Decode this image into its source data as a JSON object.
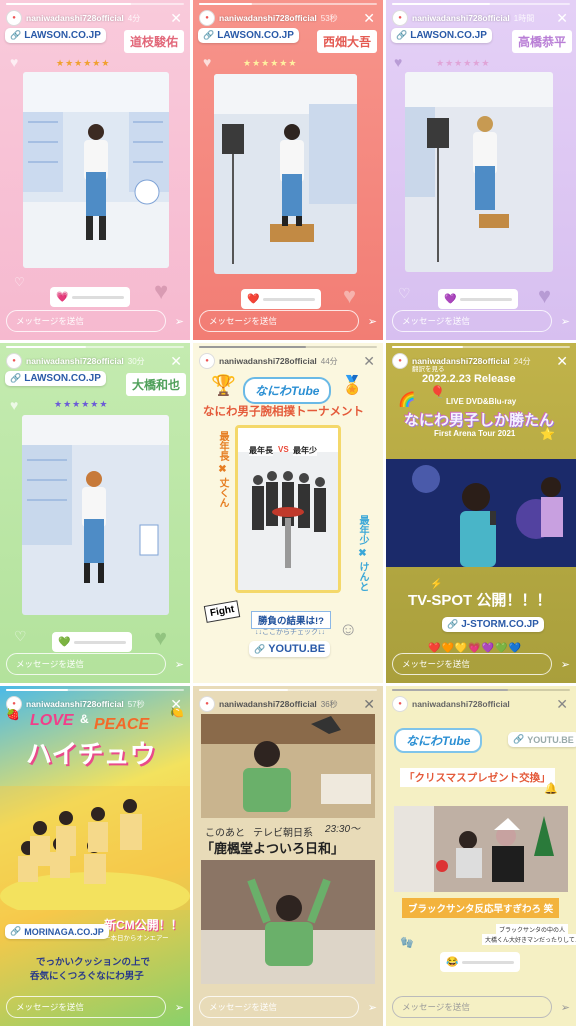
{
  "stories": [
    {
      "user": "naniwadanshi728official",
      "time": "4分",
      "link": "LAWSON.CO.JP",
      "name": "道枝駿佑",
      "name_color": "#e2687a",
      "stars": "★★★★★★",
      "slider_emoji": "💗",
      "message": "メッセージを送信",
      "bg": "#f7c0d3"
    },
    {
      "user": "naniwadanshi728official",
      "time": "53秒",
      "link": "LAWSON.CO.JP",
      "name": "西畑大吾",
      "name_color": "#e45a52",
      "stars": "★★★★★★",
      "slider_emoji": "❤️",
      "message": "メッセージを送信",
      "bg": "#f4867d"
    },
    {
      "user": "naniwadanshi728official",
      "time": "1時間",
      "link": "LAWSON.CO.JP",
      "name": "高橋恭平",
      "name_color": "#b97fd6",
      "stars": "★★★★★★",
      "slider_emoji": "💜",
      "message": "メッセージを送信",
      "bg": "#dcc5f2"
    },
    {
      "user": "naniwadanshi728official",
      "time": "30分",
      "link": "LAWSON.CO.JP",
      "name": "大橋和也",
      "name_color": "#4fa05a",
      "stars": "★★★★★★",
      "slider_emoji": "💚",
      "message": "メッセージを送信",
      "bg": "#b9e6a5"
    },
    {
      "user": "naniwadanshi728official",
      "time": "44分",
      "badge": "なにわTube",
      "title": "なにわ男子腕相撲トーナメント",
      "left_tag": "最年長 ✖ 丈くん",
      "right_tag": "最年少 ✖ けんと",
      "center_left": "最年長",
      "center_vs": "VS",
      "center_right": "最年少",
      "fight": "Fight",
      "result": "勝負の結果は!?",
      "result_sub": "↓↓ここからチェック↓↓",
      "link": "YOUTU.BE",
      "bg": "#fbf7df"
    },
    {
      "user": "naniwadanshi728official",
      "time": "24分",
      "sub": "翻訳を見る",
      "date": "2022.2.23 Release",
      "format": "LIVE DVD&Blu-ray",
      "title": "なにわ男子しか勝たん",
      "tour": "First Arena Tour 2021",
      "spot": "TV-SPOT 公開！！！",
      "link": "J-STORM.CO.JP",
      "hearts": "❤️🧡💛💗💜💚💙",
      "message": "メッセージを送信",
      "bg": "#b8ad42"
    },
    {
      "user": "naniwadanshi728official",
      "time": "57秒",
      "love": "LOVE",
      "amp": "&",
      "peace": "PEACE",
      "product": "ハイチュウ",
      "cm": "新CM公開！！",
      "cm_sub": "ー本日からオンエアー",
      "link": "MORINAGA.CO.JP",
      "caption_1": "でっかいクッションの上で",
      "caption_2": "呑気にくつろぐなにわ男子",
      "message": "メッセージを送信",
      "bg": "#f6cd46"
    },
    {
      "user": "naniwadanshi728official",
      "time": "36秒",
      "after": "このあと",
      "channel": "テレビ朝日系",
      "airtime": "23:30～",
      "program": "「鹿楓堂よついろ日和」",
      "message": "メッセージを送信",
      "bg": "#e6d7b2"
    },
    {
      "user": "naniwadanshi728official",
      "time": "",
      "badge": "なにわTube",
      "link": "YOUTU.BE",
      "title": "「クリスマスプレゼント交換」",
      "caption": "ブラックサンタ反応早すぎわろ 笑",
      "reply_1": "ブラックサンタの中の人",
      "reply_2": "大橋くん大好きマンだったりして…",
      "slider_emoji": "😂",
      "message": "メッセージを送信",
      "bg": "#f3edb9"
    }
  ]
}
